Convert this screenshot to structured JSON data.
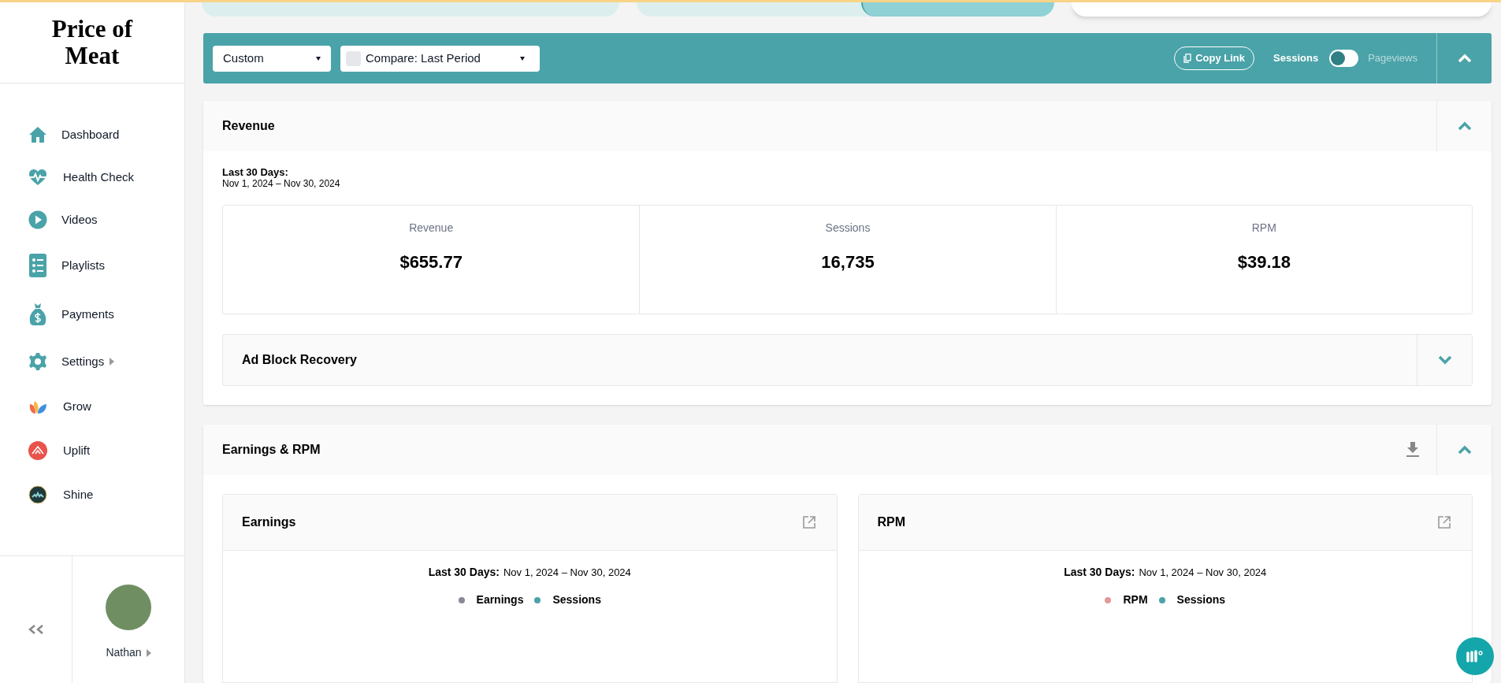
{
  "logo": {
    "text": "Price of Meat"
  },
  "nav": [
    {
      "label": "Dashboard",
      "submenu": false
    },
    {
      "label": "Health Check",
      "submenu": false
    },
    {
      "label": "Videos",
      "submenu": false
    },
    {
      "label": "Playlists",
      "submenu": false
    },
    {
      "label": "Payments",
      "submenu": false
    },
    {
      "label": "Settings",
      "submenu": true
    },
    {
      "label": "Grow",
      "submenu": false
    },
    {
      "label": "Uplift",
      "submenu": false
    },
    {
      "label": "Shine",
      "submenu": false
    }
  ],
  "user": {
    "name": "Nathan"
  },
  "filter_bar": {
    "range": "Custom",
    "compare": "Compare: Last Period",
    "compare_checked": false,
    "copy_link": "Copy Link",
    "toggle_left": "Sessions",
    "toggle_right": "Pageviews",
    "toggle_on": false,
    "expanded": true
  },
  "revenue": {
    "title": "Revenue",
    "expanded": true,
    "period_label": "Last 30 Days:",
    "period": "Nov 1, 2024 – Nov 30, 2024",
    "stats": [
      {
        "label": "Revenue",
        "value": "$655.77"
      },
      {
        "label": "Sessions",
        "value": "16,735"
      },
      {
        "label": "RPM",
        "value": "$39.18"
      }
    ],
    "ad_block": {
      "title": "Ad Block Recovery",
      "expanded": false
    }
  },
  "earnings_rpm": {
    "title": "Earnings & RPM",
    "expanded": true,
    "cards": [
      {
        "title": "Earnings",
        "period_label": "Last 30 Days:",
        "period": "Nov 1, 2024 – Nov 30, 2024",
        "legend": [
          {
            "label": "Earnings",
            "color": "#8a8797"
          },
          {
            "label": "Sessions",
            "color": "#4aa3a8"
          }
        ]
      },
      {
        "title": "RPM",
        "period_label": "Last 30 Days:",
        "period": "Nov 1, 2024 – Nov 30, 2024",
        "legend": [
          {
            "label": "RPM",
            "color": "#e39a9a"
          },
          {
            "label": "Sessions",
            "color": "#4aa3a8"
          }
        ]
      }
    ]
  }
}
